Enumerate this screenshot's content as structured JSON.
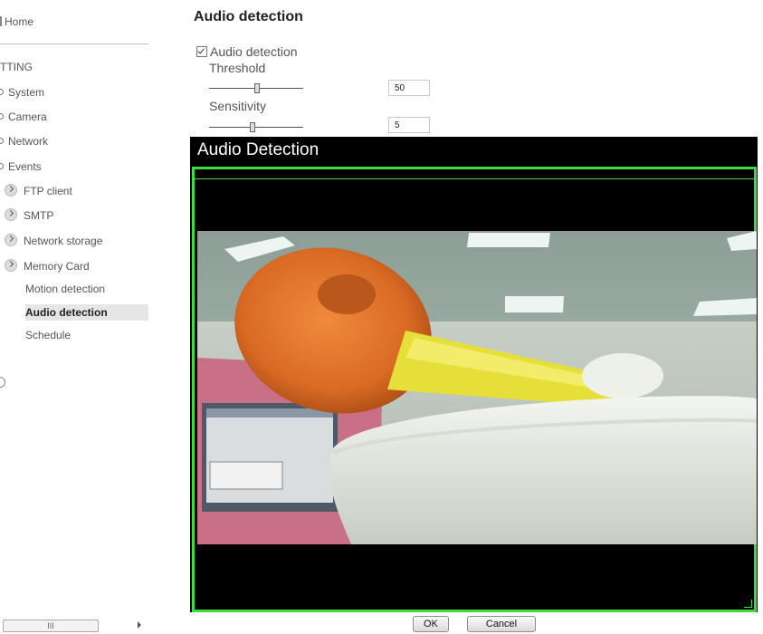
{
  "sidebar": {
    "home": "Home",
    "heading": "TTING",
    "items": [
      {
        "label": "System"
      },
      {
        "label": "Camera"
      },
      {
        "label": "Network"
      },
      {
        "label": "Events"
      }
    ],
    "sub_items": [
      {
        "label": "FTP client"
      },
      {
        "label": "SMTP"
      },
      {
        "label": "Network storage"
      },
      {
        "label": "Memory Card"
      }
    ],
    "leaf_items": [
      {
        "label": "Motion detection"
      },
      {
        "label": "Audio detection"
      },
      {
        "label": "Schedule"
      }
    ],
    "active_item": "Audio detection",
    "scrollbar_grip": "III"
  },
  "main": {
    "title": "Audio detection",
    "checkbox_label": "Audio detection",
    "checkbox_checked": true,
    "threshold": {
      "label": "Threshold",
      "value": "50",
      "level": 0.5
    },
    "sensitivity": {
      "label": "Sensitivity",
      "value": "5",
      "level": 0.45
    }
  },
  "panel": {
    "title": "Audio Detection"
  },
  "buttons": {
    "ok": "OK",
    "cancel": "Cancel"
  },
  "colors": {
    "detection_border": "#3fdc3f",
    "panel_bg": "#000000",
    "active_item_bg": "#e6e6e6"
  }
}
